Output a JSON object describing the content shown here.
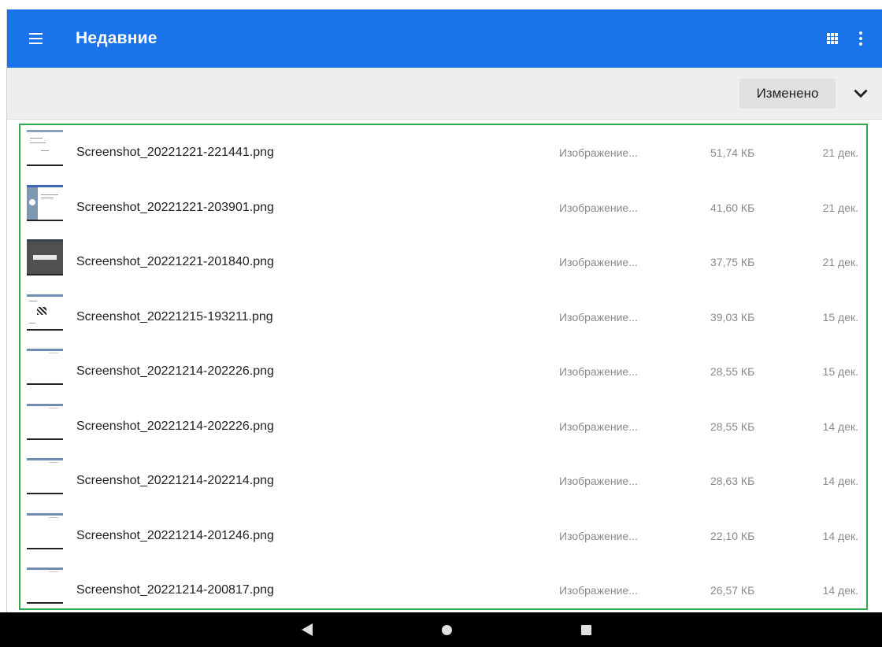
{
  "appbar": {
    "title": "Недавние",
    "color": "#1a73e8",
    "icons": [
      "menu-icon",
      "grid-view-icon",
      "more-vert-icon"
    ]
  },
  "sortbar": {
    "sort_label": "Изменено",
    "icon": "chevron-down-icon"
  },
  "files": [
    {
      "name": "Screenshot_20221221-221441.png",
      "type": "Изображение...",
      "size": "51,74 КБ",
      "date": "21 дек.",
      "thumb": "doc"
    },
    {
      "name": "Screenshot_20221221-203901.png",
      "type": "Изображение...",
      "size": "41,60 КБ",
      "date": "21 дек.",
      "thumb": "sidebar"
    },
    {
      "name": "Screenshot_20221221-201840.png",
      "type": "Изображение...",
      "size": "37,75 КБ",
      "date": "21 дек.",
      "thumb": "dark"
    },
    {
      "name": "Screenshot_20221215-193211.png",
      "type": "Изображение...",
      "size": "39,03 КБ",
      "date": "15 дек.",
      "thumb": "qr"
    },
    {
      "name": "Screenshot_20221214-202226.png",
      "type": "Изображение...",
      "size": "28,55 КБ",
      "date": "15 дек.",
      "thumb": "plain"
    },
    {
      "name": "Screenshot_20221214-202226.png",
      "type": "Изображение...",
      "size": "28,55 КБ",
      "date": "14 дек.",
      "thumb": "plain"
    },
    {
      "name": "Screenshot_20221214-202214.png",
      "type": "Изображение...",
      "size": "28,63 КБ",
      "date": "14 дек.",
      "thumb": "plain"
    },
    {
      "name": "Screenshot_20221214-201246.png",
      "type": "Изображение...",
      "size": "22,10 КБ",
      "date": "14 дек.",
      "thumb": "plain"
    },
    {
      "name": "Screenshot_20221214-200817.png",
      "type": "Изображение...",
      "size": "26,57 КБ",
      "date": "14 дек.",
      "thumb": "plain"
    }
  ],
  "navbar": {
    "icons": [
      "back-icon",
      "home-icon",
      "recents-icon"
    ]
  }
}
